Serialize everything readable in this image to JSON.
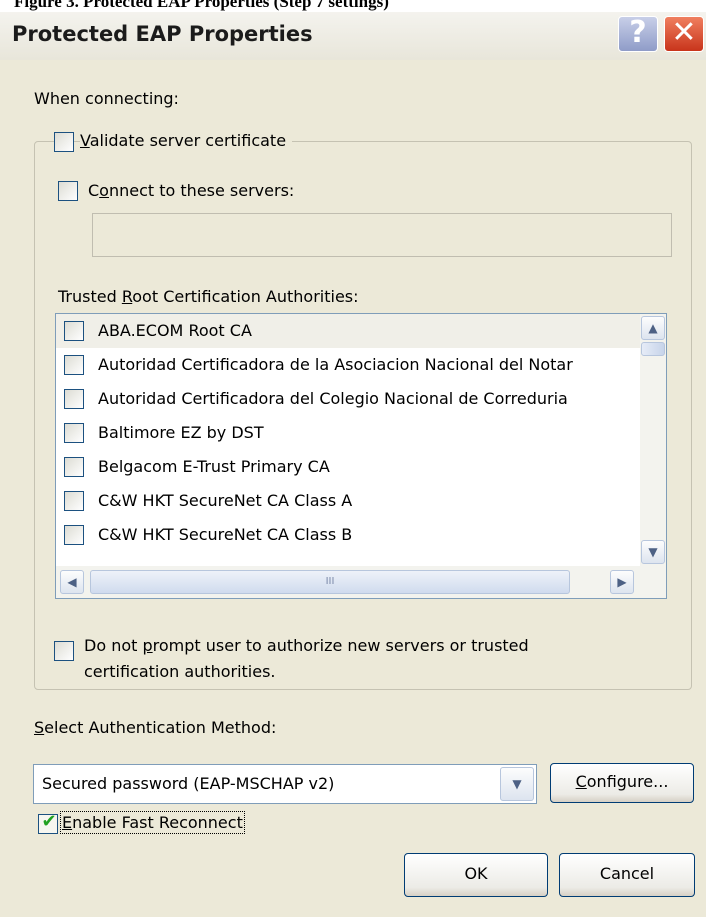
{
  "caption": "Figure 3. Protected EAP Properties (Step 7 settings)",
  "window": {
    "title": "Protected EAP Properties",
    "help_glyph": "?",
    "close_glyph": "✕"
  },
  "when_connecting_label": "When connecting:",
  "validate_server_certificate": {
    "label": "alidate server certificate",
    "mnemonic": "V",
    "checked": false
  },
  "connect_to_servers": {
    "label_pre": "C",
    "mnemonic": "o",
    "label_post": "nnect to these servers:",
    "checked": false,
    "value": ""
  },
  "trusted_root": {
    "label_pre": "Trusted ",
    "mnemonic": "R",
    "label_post": "oot Certification Authorities:",
    "items": [
      {
        "label": "ABA.ECOM Root CA",
        "checked": false
      },
      {
        "label": "Autoridad Certificadora de la Asociacion Nacional del Notar",
        "checked": false
      },
      {
        "label": "Autoridad Certificadora del Colegio Nacional de Correduria",
        "checked": false
      },
      {
        "label": "Baltimore EZ by DST",
        "checked": false
      },
      {
        "label": "Belgacom E-Trust Primary CA",
        "checked": false
      },
      {
        "label": "C&W HKT SecureNet CA Class A",
        "checked": false
      },
      {
        "label": "C&W HKT SecureNet CA Class B",
        "checked": false
      }
    ]
  },
  "do_not_prompt": {
    "line1_pre": "Do not ",
    "mnemonic": "p",
    "line1_post": "rompt user to authorize new servers or trusted",
    "line2": "certification authorities.",
    "checked": false
  },
  "auth_method": {
    "label_pre": "",
    "mnemonic": "S",
    "label_post": "elect Authentication Method:",
    "selected": "Secured password (EAP-MSCHAP v2)"
  },
  "configure_button": {
    "mnemonic": "C",
    "label_post": "onfigure..."
  },
  "fast_reconnect": {
    "mnemonic": "E",
    "label_post": "nable Fast Reconnect",
    "checked": true
  },
  "ok_button": "OK",
  "cancel_button": "Cancel",
  "icons": {
    "scroll_up": "▲",
    "scroll_down": "▼",
    "scroll_left": "◀",
    "scroll_right": "▶",
    "grip": "III",
    "dropdown": "▼",
    "checkmark": "✔"
  }
}
